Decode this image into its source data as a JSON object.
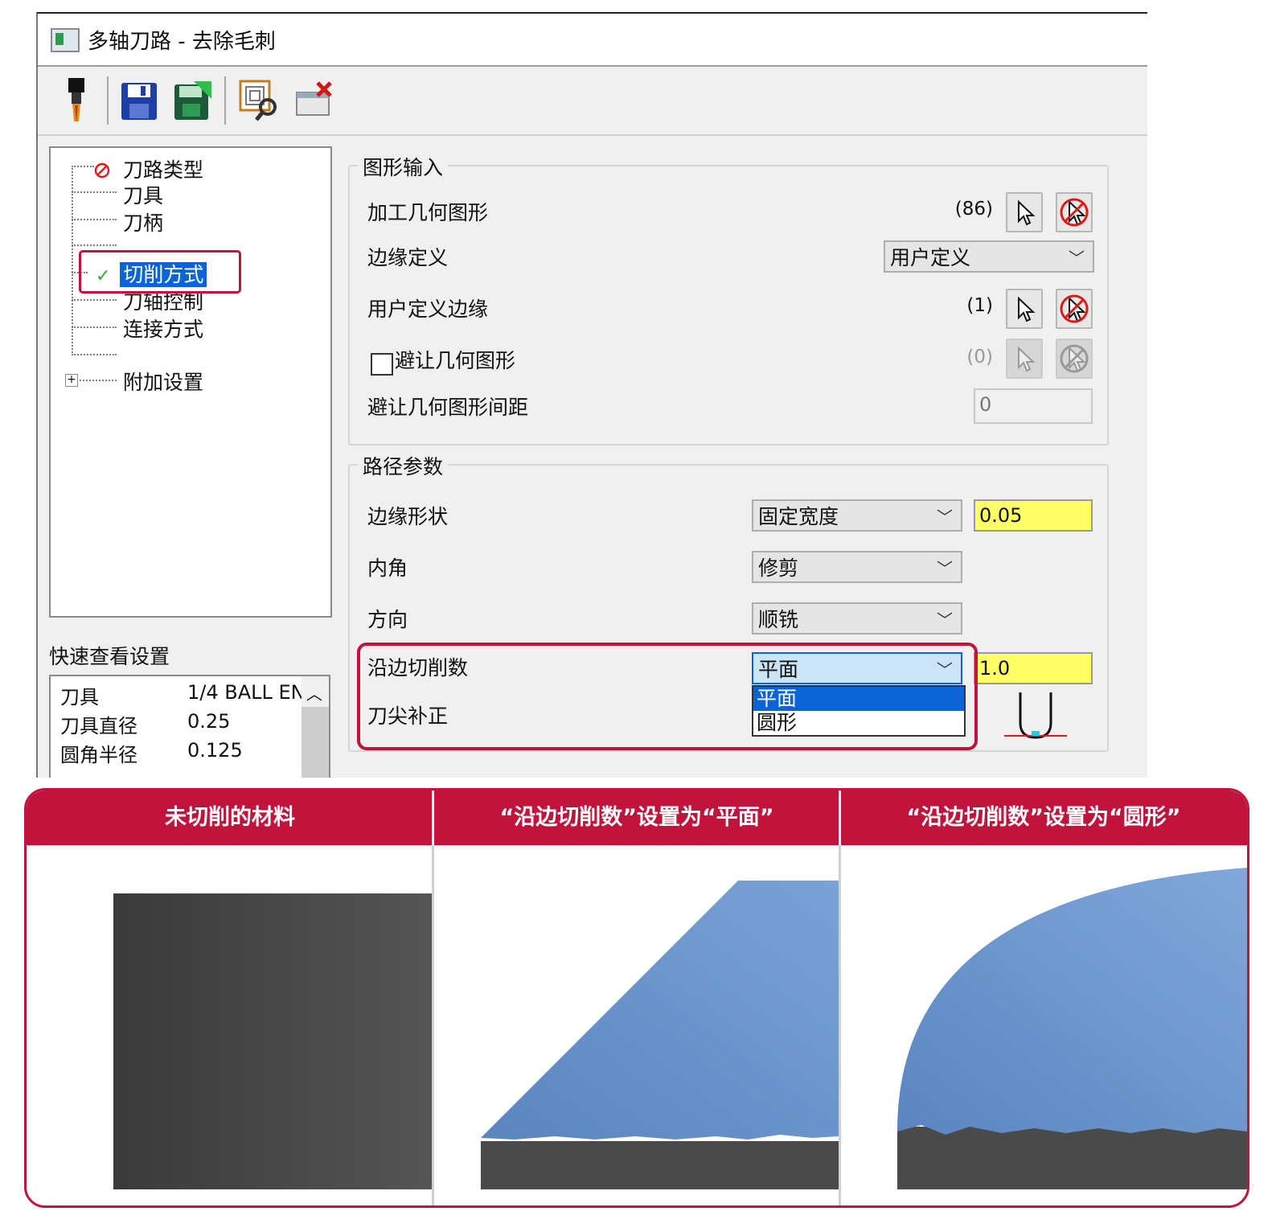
{
  "window": {
    "title": "多轴刀路 - 去除毛刺"
  },
  "toolbar": {
    "icons": [
      "tool-icon",
      "save-icon",
      "save-apply-icon",
      "preview-icon",
      "cancel-icon"
    ]
  },
  "tree": {
    "items": [
      {
        "label": "刀路类型",
        "status": "error"
      },
      {
        "label": "刀具"
      },
      {
        "label": "刀柄"
      },
      {
        "label": "切削方式",
        "status": "ok",
        "selected": true
      },
      {
        "label": "刀轴控制"
      },
      {
        "label": "连接方式"
      },
      {
        "label": "附加设置",
        "expandable": true
      }
    ]
  },
  "quick_view": {
    "title": "快速查看设置",
    "rows": [
      {
        "label": "刀具",
        "value": "1/4 BALL EN"
      },
      {
        "label": "刀具直径",
        "value": "0.25"
      },
      {
        "label": "圆角半径",
        "value": "0.125"
      }
    ]
  },
  "geometry_input": {
    "title": "图形输入",
    "machining_geometry": {
      "label": "加工几何图形",
      "count": "(86)"
    },
    "edge_definition": {
      "label": "边缘定义",
      "value": "用户定义"
    },
    "user_edges": {
      "label": "用户定义边缘",
      "count": "(1)"
    },
    "avoid_geometry": {
      "label": "避让几何图形",
      "count": "(0)",
      "checked": false
    },
    "avoid_distance": {
      "label": "避让几何图形间距",
      "value": "0"
    }
  },
  "path_params": {
    "title": "路径参数",
    "edge_shape": {
      "label": "边缘形状",
      "value": "固定宽度",
      "amount": "0.05"
    },
    "inner_corner": {
      "label": "内角",
      "value": "修剪"
    },
    "direction": {
      "label": "方向",
      "value": "顺铣"
    },
    "edge_cuts": {
      "label": "沿边切削数",
      "value": "平面",
      "amount": "1.0",
      "options": [
        "平面",
        "圆形"
      ]
    },
    "tip_comp": {
      "label": "刀尖补正"
    }
  },
  "comparison": {
    "headers": [
      "未切削的材料",
      "“沿边切削数”设置为“平面”",
      "“沿边切削数”设置为“圆形”"
    ],
    "colors": {
      "accent": "#c0143c",
      "stock": "#4a4a4a",
      "cut": "#6a96cc"
    }
  }
}
